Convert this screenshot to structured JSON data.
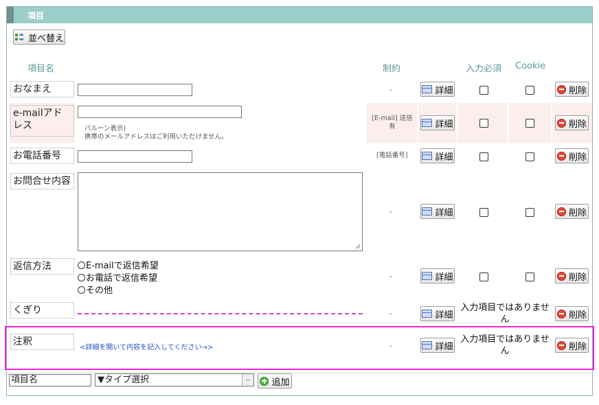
{
  "panel": {
    "title": "項目"
  },
  "toolbar": {
    "sort_label": "並べ替え"
  },
  "columns": {
    "name": "項目名",
    "constraint": "制約",
    "required": "入力必須",
    "cookie": "Cookie"
  },
  "buttons": {
    "detail": "詳細",
    "delete": "削除",
    "add": "追加"
  },
  "rows": [
    {
      "label": "おなまえ",
      "constraint": "-"
    },
    {
      "label": "e-mailアドレス",
      "constraint": "[E-mail] 送信有",
      "note1": "バルーン表示)",
      "note2": "携帯のメールアドレスはご利用いただけません。"
    },
    {
      "label": "お電話番号",
      "constraint": "[電話番号]"
    },
    {
      "label": "お問合せ内容",
      "constraint": "-"
    },
    {
      "label": "返信方法",
      "constraint": "-",
      "options": [
        "E-mailで返信希望",
        "お電話で返信希望",
        "その他"
      ]
    },
    {
      "label": "くぎり",
      "constraint": "-",
      "not_input": "入力項目ではありませ ん"
    },
    {
      "label": "注釈",
      "constraint": "-",
      "annotation": "<詳細を開いて内容を記入してください→>",
      "not_input": "入力項目ではありませ ん"
    }
  ],
  "footer": {
    "name_value": "項目名",
    "type_select": "▼タイプ選択"
  },
  "colors": {
    "header": "#9bcdca",
    "pink_row": "#fdeeee",
    "highlight": "#ee22dd",
    "column_header": "#5a9a98"
  }
}
